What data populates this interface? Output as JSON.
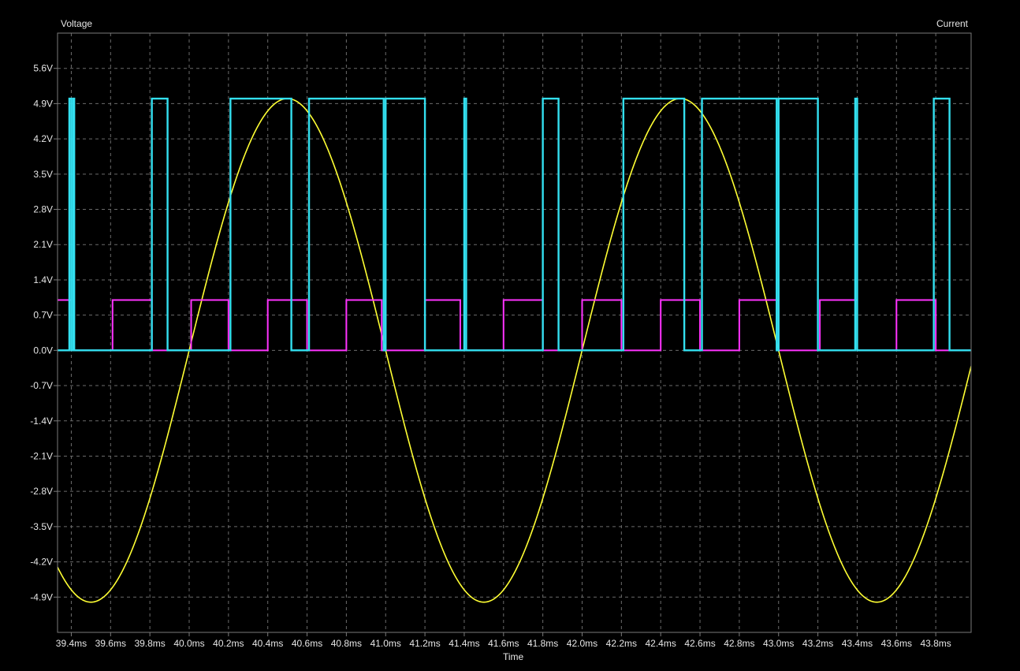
{
  "chart_data": {
    "type": "line",
    "ylabel": "Voltage",
    "y2label": "Current",
    "xlabel": "Time",
    "xlim": [
      39.33,
      43.98
    ],
    "ylim": [
      -5.6,
      6.3
    ],
    "grid": true,
    "background": "#000000",
    "grid_color": "#6b6b6b",
    "frame_color": "#7a7a7a",
    "y_ticks": [
      {
        "value": 5.6,
        "label": "5.6V"
      },
      {
        "value": 4.9,
        "label": "4.9V"
      },
      {
        "value": 4.2,
        "label": "4.2V"
      },
      {
        "value": 3.5,
        "label": "3.5V"
      },
      {
        "value": 2.8,
        "label": "2.8V"
      },
      {
        "value": 2.1,
        "label": "2.1V"
      },
      {
        "value": 1.4,
        "label": "1.4V"
      },
      {
        "value": 0.7,
        "label": "0.7V"
      },
      {
        "value": 0.0,
        "label": "0.0V"
      },
      {
        "value": -0.7,
        "label": "-0.7V"
      },
      {
        "value": -1.4,
        "label": "-1.4V"
      },
      {
        "value": -2.1,
        "label": "-2.1V"
      },
      {
        "value": -2.8,
        "label": "-2.8V"
      },
      {
        "value": -3.5,
        "label": "-3.5V"
      },
      {
        "value": -4.2,
        "label": "-4.2V"
      },
      {
        "value": -4.9,
        "label": "-4.9V"
      }
    ],
    "x_ticks": [
      {
        "value": 39.4,
        "label": "39.4ms"
      },
      {
        "value": 39.6,
        "label": "39.6ms"
      },
      {
        "value": 39.8,
        "label": "39.8ms"
      },
      {
        "value": 40.0,
        "label": "40.0ms"
      },
      {
        "value": 40.2,
        "label": "40.2ms"
      },
      {
        "value": 40.4,
        "label": "40.4ms"
      },
      {
        "value": 40.6,
        "label": "40.6ms"
      },
      {
        "value": 40.8,
        "label": "40.8ms"
      },
      {
        "value": 41.0,
        "label": "41.0ms"
      },
      {
        "value": 41.2,
        "label": "41.2ms"
      },
      {
        "value": 41.4,
        "label": "41.4ms"
      },
      {
        "value": 41.6,
        "label": "41.6ms"
      },
      {
        "value": 41.8,
        "label": "41.8ms"
      },
      {
        "value": 42.0,
        "label": "42.0ms"
      },
      {
        "value": 42.2,
        "label": "42.2ms"
      },
      {
        "value": 42.4,
        "label": "42.4ms"
      },
      {
        "value": 42.6,
        "label": "42.6ms"
      },
      {
        "value": 42.8,
        "label": "42.8ms"
      },
      {
        "value": 43.0,
        "label": "43.0ms"
      },
      {
        "value": 43.2,
        "label": "43.2ms"
      },
      {
        "value": 43.4,
        "label": "43.4ms"
      },
      {
        "value": 43.6,
        "label": "43.6ms"
      },
      {
        "value": 43.8,
        "label": "43.8ms"
      }
    ],
    "series": [
      {
        "color": "#ffff33",
        "kind": "sine",
        "amplitude": 5.0,
        "period_ms": 2.0,
        "zero_crossing_rising_ms": 40.0
      },
      {
        "color": "#ff33ff",
        "kind": "step",
        "high": 1.0,
        "x": [
          39.33,
          39.4,
          39.4,
          39.61,
          39.61,
          39.81,
          39.81,
          40.01,
          40.01,
          40.2,
          40.2,
          40.4,
          40.4,
          40.6,
          40.6,
          40.8,
          40.8,
          40.98,
          40.98,
          41.2,
          41.2,
          41.38,
          41.38,
          41.6,
          41.6,
          41.8,
          41.8,
          42.0,
          42.0,
          42.2,
          42.2,
          42.4,
          42.4,
          42.6,
          42.6,
          42.8,
          42.8,
          43.0,
          43.0,
          43.21,
          43.21,
          43.4,
          43.4,
          43.6,
          43.6,
          43.8,
          43.8,
          43.98
        ],
        "y": [
          1.0,
          1.0,
          0.0,
          0.0,
          1.0,
          1.0,
          0.0,
          0.0,
          1.0,
          1.0,
          0.0,
          0.0,
          1.0,
          1.0,
          0.0,
          0.0,
          1.0,
          1.0,
          0.0,
          0.0,
          1.0,
          1.0,
          0.0,
          0.0,
          1.0,
          1.0,
          0.0,
          0.0,
          1.0,
          1.0,
          0.0,
          0.0,
          1.0,
          1.0,
          0.0,
          0.0,
          1.0,
          1.0,
          0.0,
          0.0,
          1.0,
          1.0,
          0.0,
          0.0,
          1.0,
          1.0,
          0.0,
          0.0
        ]
      },
      {
        "color": "#33e0f0",
        "kind": "pulses",
        "high": 5.0,
        "pulses": [
          [
            39.39,
            39.4
          ],
          [
            39.41,
            39.415
          ],
          [
            39.81,
            39.89
          ],
          [
            40.21,
            40.52
          ],
          [
            40.61,
            40.99
          ],
          [
            41.0,
            41.2
          ],
          [
            41.4,
            41.41
          ],
          [
            41.8,
            41.88
          ],
          [
            42.21,
            42.52
          ],
          [
            42.61,
            42.99
          ],
          [
            43.0,
            43.2
          ],
          [
            43.39,
            43.4
          ],
          [
            43.79,
            43.87
          ]
        ]
      }
    ]
  }
}
